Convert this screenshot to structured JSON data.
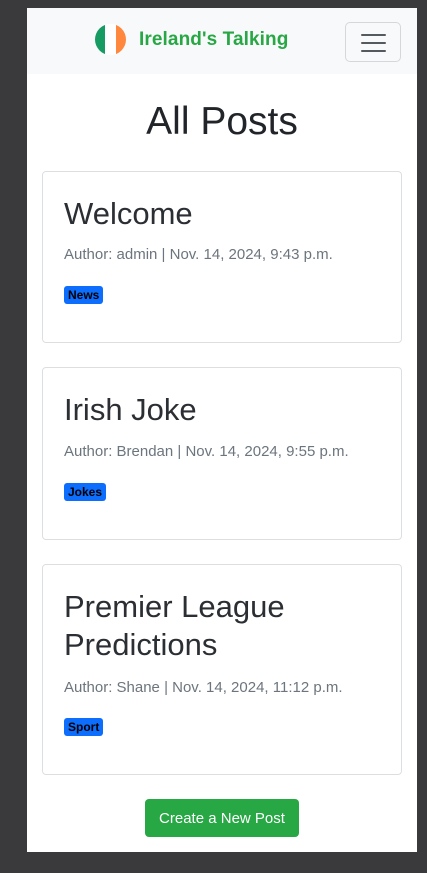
{
  "navbar": {
    "brand": "Ireland's Talking",
    "flag_colors": [
      "#169b62",
      "#ffffff",
      "#ff883e"
    ]
  },
  "page": {
    "title": "All Posts"
  },
  "posts": [
    {
      "title": "Welcome",
      "meta": "Author: admin | Nov. 14, 2024, 9:43 p.m.",
      "tag": "News"
    },
    {
      "title": "Irish Joke",
      "meta": "Author: Brendan | Nov. 14, 2024, 9:55 p.m.",
      "tag": "Jokes"
    },
    {
      "title": "Premier League Predictions",
      "meta": "Author: Shane | Nov. 14, 2024, 11:12 p.m.",
      "tag": "Sport"
    }
  ],
  "actions": {
    "create_label": "Create a New Post"
  },
  "colors": {
    "brand": "#28a745",
    "badge": "#0d6efd",
    "muted_text": "#6c757d"
  }
}
